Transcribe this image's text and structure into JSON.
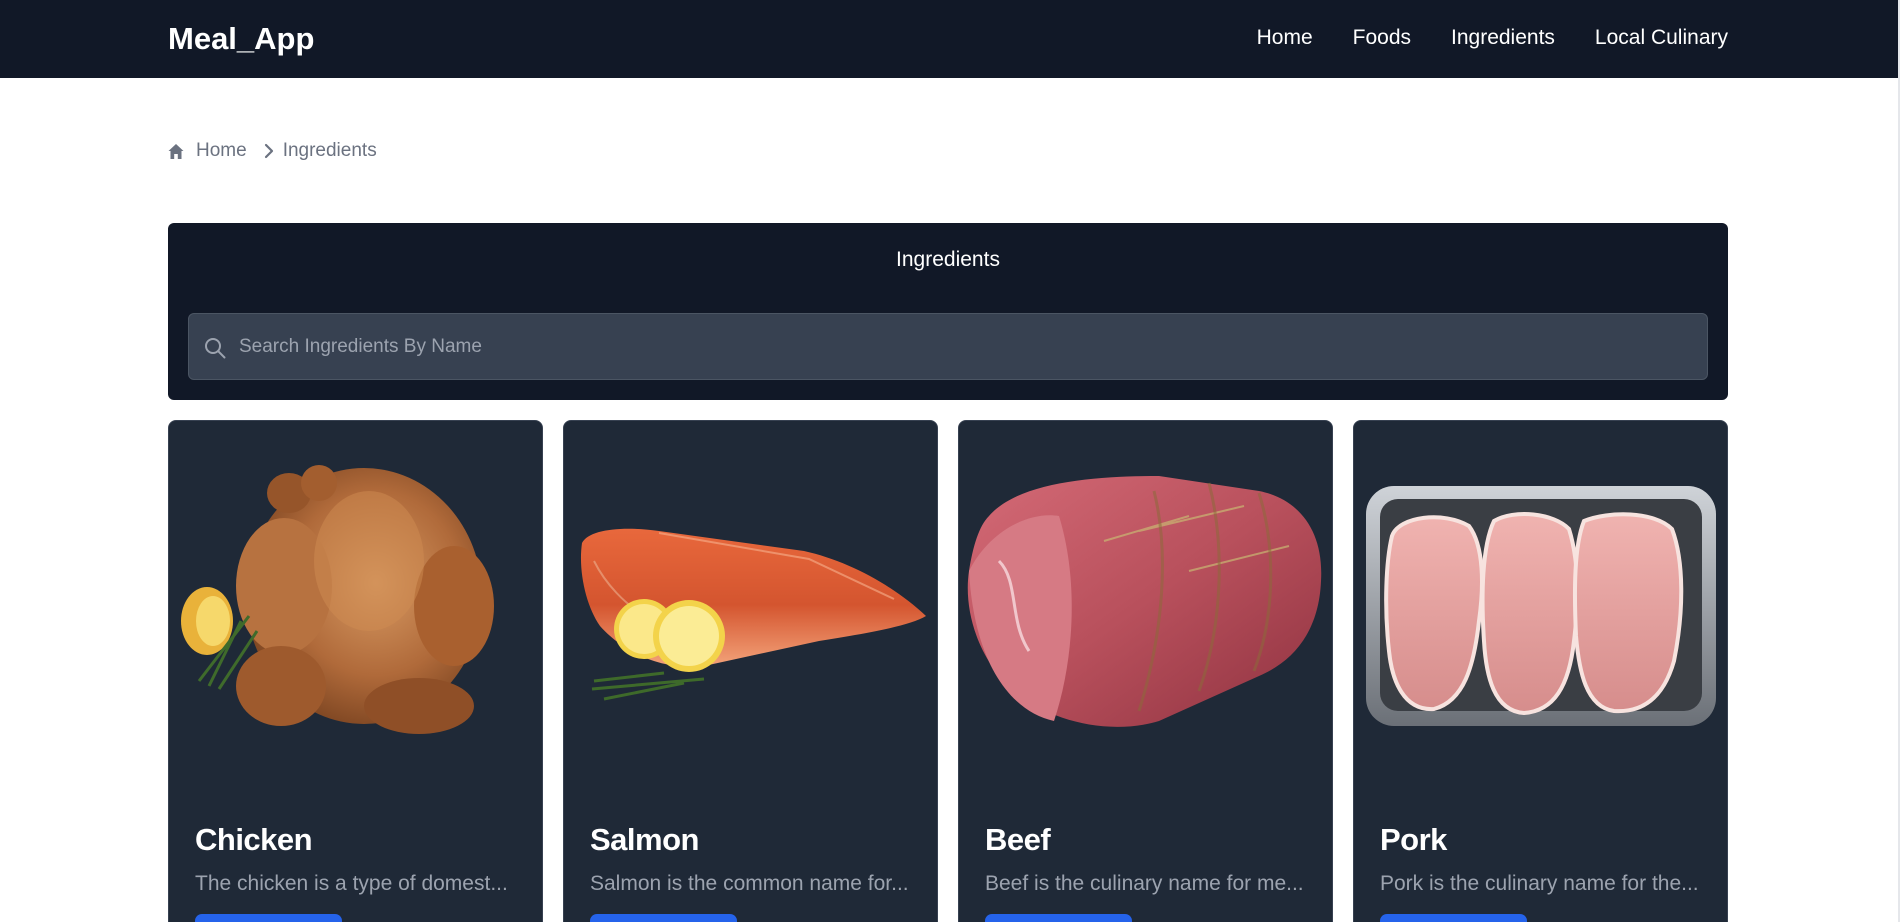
{
  "navbar": {
    "brand": "Meal_App",
    "links": [
      "Home",
      "Foods",
      "Ingredients",
      "Local Culinary"
    ]
  },
  "breadcrumb": {
    "home_icon": "home-icon",
    "home": "Home",
    "separator_icon": "chevron-right-icon",
    "current": "Ingredients"
  },
  "search_panel": {
    "title": "Ingredients",
    "icon": "search-icon",
    "placeholder": "Search Ingredients By Name",
    "value": ""
  },
  "cards": [
    {
      "title": "Chicken",
      "description": "The chicken is a type of domest...",
      "image": "roast-chicken-image"
    },
    {
      "title": "Salmon",
      "description": "Salmon is the common name for...",
      "image": "salmon-fillet-image"
    },
    {
      "title": "Beef",
      "description": "Beef is the culinary name for me...",
      "image": "beef-roast-image"
    },
    {
      "title": "Pork",
      "description": "Pork is the culinary name for the...",
      "image": "pork-chops-tray-image"
    }
  ],
  "colors": {
    "navbar_bg": "#111827",
    "card_bg": "#1f2937",
    "search_bg": "#374151",
    "button": "#2563eb",
    "muted_text": "#9ca3af"
  }
}
